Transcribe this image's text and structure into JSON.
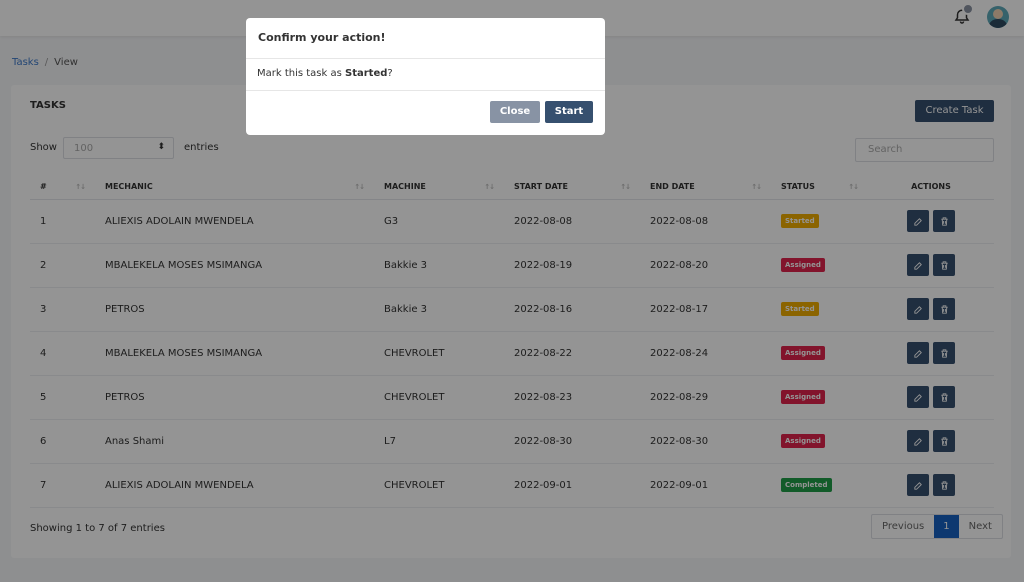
{
  "breadcrumb": {
    "parent": "Tasks",
    "separator": "/",
    "current": "View"
  },
  "card": {
    "title": "TASKS",
    "create_label": "Create Task"
  },
  "controls": {
    "show_label": "Show",
    "entries_value": "100",
    "entries_label": "entries",
    "search_placeholder": "Search"
  },
  "columns": [
    "#",
    "MECHANIC",
    "MACHINE",
    "START DATE",
    "END DATE",
    "STATUS",
    "ACTIONS"
  ],
  "rows": [
    {
      "id": "1",
      "mechanic": "ALIEXIS ADOLAIN MWENDELA",
      "machine": "G3",
      "start": "2022-08-08",
      "end": "2022-08-08",
      "status": "Started"
    },
    {
      "id": "2",
      "mechanic": "MBALEKELA MOSES MSIMANGA",
      "machine": "Bakkie 3",
      "start": "2022-08-19",
      "end": "2022-08-20",
      "status": "Assigned"
    },
    {
      "id": "3",
      "mechanic": "PETROS",
      "machine": "Bakkie 3",
      "start": "2022-08-16",
      "end": "2022-08-17",
      "status": "Started"
    },
    {
      "id": "4",
      "mechanic": "MBALEKELA MOSES MSIMANGA",
      "machine": "CHEVROLET",
      "start": "2022-08-22",
      "end": "2022-08-24",
      "status": "Assigned"
    },
    {
      "id": "5",
      "mechanic": "PETROS",
      "machine": "CHEVROLET",
      "start": "2022-08-23",
      "end": "2022-08-29",
      "status": "Assigned"
    },
    {
      "id": "6",
      "mechanic": "Anas Shami",
      "machine": "L7",
      "start": "2022-08-30",
      "end": "2022-08-30",
      "status": "Assigned"
    },
    {
      "id": "7",
      "mechanic": "ALIEXIS ADOLAIN MWENDELA",
      "machine": "CHEVROLET",
      "start": "2022-09-01",
      "end": "2022-09-01",
      "status": "Completed"
    }
  ],
  "status_colors": {
    "Started": "#f0ad00",
    "Assigned": "#e0244c",
    "Completed": "#1f9d48"
  },
  "footer": {
    "showing": "Showing 1 to 7 of 7 entries",
    "previous": "Previous",
    "page": "1",
    "next": "Next"
  },
  "modal": {
    "title": "Confirm your action!",
    "body_prefix": "Mark this task as ",
    "body_status": "Started",
    "body_suffix": "?",
    "close_label": "Close",
    "start_label": "Start"
  },
  "icons": {
    "notification": "bell-icon",
    "user": "avatar",
    "edit": "edit-icon",
    "delete": "trash-icon",
    "sort": "sort-icon",
    "select": "chevron-updown-icon"
  }
}
